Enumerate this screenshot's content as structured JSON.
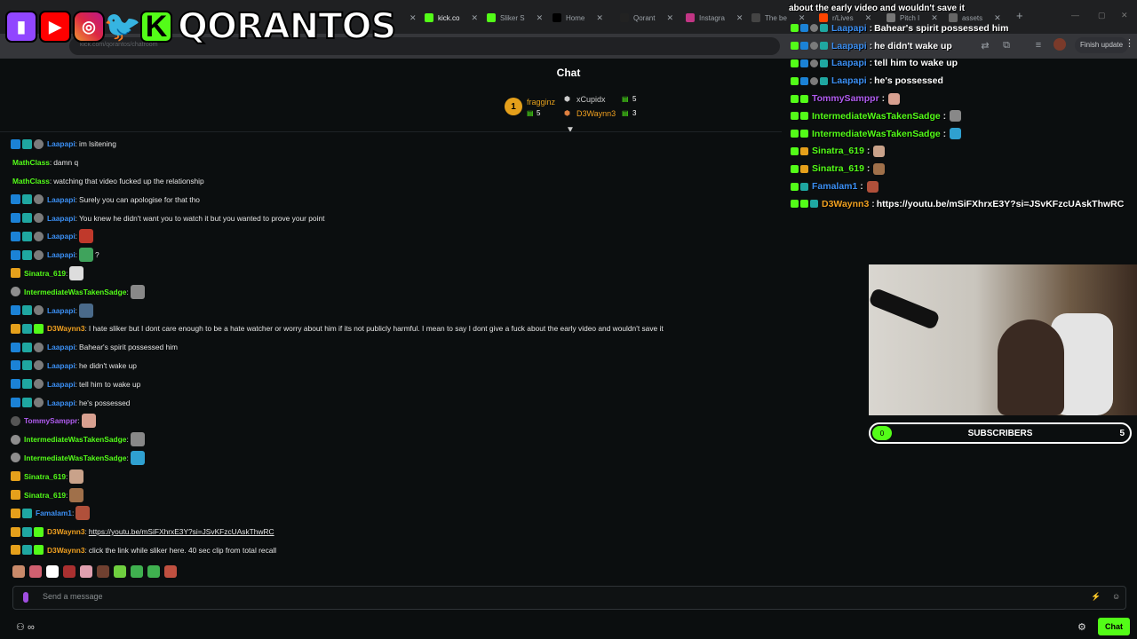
{
  "browser": {
    "tabs": [
      {
        "label": "",
        "active": false
      },
      {
        "label": "kick.co",
        "active": true
      },
      {
        "label": "Sliker S",
        "active": false
      },
      {
        "label": "Home",
        "active": false
      },
      {
        "label": "Qorant",
        "active": false
      },
      {
        "label": "Instagra",
        "active": false
      },
      {
        "label": "The be",
        "active": false
      },
      {
        "label": "r/Lives",
        "active": false
      },
      {
        "label": "Pitch I",
        "active": false
      },
      {
        "label": "assets",
        "active": false
      }
    ],
    "new_tab": "+",
    "url": "kick.com/qorantos/chatroom",
    "finish_update": "Finish update"
  },
  "overlay_brand": {
    "name": "QORANTOS"
  },
  "chat": {
    "header": "Chat",
    "leaderboard": [
      {
        "rank": "1",
        "name": "fragginz",
        "count": "5"
      },
      {
        "name": "xCupidx",
        "count": "5"
      },
      {
        "name": "D3Waynn3",
        "count": "3"
      }
    ],
    "messages": [
      {
        "badges": [
          "mod",
          "sub",
          "og"
        ],
        "user": "Laapapi",
        "color": "#3b8ff3",
        "text": "im lsitening"
      },
      {
        "badges": [],
        "user": "MathClass",
        "color": "#53fc18",
        "text": "damn q"
      },
      {
        "badges": [],
        "user": "MathClass",
        "color": "#53fc18",
        "text": "watching that video fucked up the relationship"
      },
      {
        "badges": [
          "mod",
          "sub",
          "og"
        ],
        "user": "Laapapi",
        "color": "#3b8ff3",
        "text": "Surely you can apologise for that tho"
      },
      {
        "badges": [
          "mod",
          "sub",
          "og"
        ],
        "user": "Laapapi",
        "color": "#3b8ff3",
        "text": "You knew he didn't want you to watch it but you wanted to prove your point"
      },
      {
        "badges": [
          "mod",
          "sub",
          "og"
        ],
        "user": "Laapapi",
        "color": "#3b8ff3",
        "text": "",
        "emote": "#c0392b"
      },
      {
        "badges": [
          "mod",
          "sub",
          "og"
        ],
        "user": "Laapapi",
        "color": "#3b8ff3",
        "text": "?",
        "emote": "#3fa35c"
      },
      {
        "badges": [
          "vip"
        ],
        "user": "Sinatra_619",
        "color": "#53fc18",
        "text": "",
        "emote": "#dddddd"
      },
      {
        "badges": [
          "founder"
        ],
        "user": "IntermediateWasTakenSadge",
        "color": "#53fc18",
        "text": "",
        "emote": "#888888"
      },
      {
        "badges": [
          "mod",
          "sub",
          "og"
        ],
        "user": "Laapapi",
        "color": "#3b8ff3",
        "text": "",
        "emote": "#4a6a8a"
      },
      {
        "badges": [
          "vip",
          "sub",
          "gift"
        ],
        "user": "D3Waynn3",
        "color": "#f0a020",
        "text": "I hate sliker but I dont care enough to be a hate watcher or worry about him if its not publicly harmful. I mean to say I dont give a fuck about the early video and wouldn't save it"
      },
      {
        "badges": [
          "mod",
          "sub",
          "og"
        ],
        "user": "Laapapi",
        "color": "#3b8ff3",
        "text": "Bahear's spirit possessed him"
      },
      {
        "badges": [
          "mod",
          "sub",
          "og"
        ],
        "user": "Laapapi",
        "color": "#3b8ff3",
        "text": "he didn't wake up"
      },
      {
        "badges": [
          "mod",
          "sub",
          "og"
        ],
        "user": "Laapapi",
        "color": "#3b8ff3",
        "text": "tell him to wake up"
      },
      {
        "badges": [
          "mod",
          "sub",
          "og"
        ],
        "user": "Laapapi",
        "color": "#3b8ff3",
        "text": "he's possessed"
      },
      {
        "badges": [
          "gray"
        ],
        "user": "TommySamppr",
        "color": "#b05cf0",
        "text": "",
        "emote": "#d8a090"
      },
      {
        "badges": [
          "founder"
        ],
        "user": "IntermediateWasTakenSadge",
        "color": "#53fc18",
        "text": "",
        "emote": "#888888"
      },
      {
        "badges": [
          "founder"
        ],
        "user": "IntermediateWasTakenSadge",
        "color": "#53fc18",
        "text": "",
        "emote": "#2fa0d0"
      },
      {
        "badges": [
          "vip"
        ],
        "user": "Sinatra_619",
        "color": "#53fc18",
        "text": "",
        "emote": "#c9a28a"
      },
      {
        "badges": [
          "vip"
        ],
        "user": "Sinatra_619",
        "color": "#53fc18",
        "text": "",
        "emote": "#a0704a"
      },
      {
        "badges": [
          "vip",
          "sub"
        ],
        "user": "Famalam1",
        "color": "#3b8ff3",
        "text": "",
        "emote": "#b0503a"
      },
      {
        "badges": [
          "vip",
          "sub",
          "gift"
        ],
        "user": "D3Waynn3",
        "color": "#f0a020",
        "text": "https://youtu.be/mSiFXhrxE3Y?si=JSvKFzcUAskThwRC",
        "link": true
      },
      {
        "badges": [
          "vip",
          "sub",
          "gift"
        ],
        "user": "D3Waynn3",
        "color": "#f0a020",
        "text": "click the link while sliker here. 40 sec clip from total recall"
      }
    ],
    "emote_strip": [
      "#c98a6a",
      "#d06070",
      "#ffffff",
      "#aa3030",
      "#e0a0b0",
      "#704030",
      "#6fcf3f",
      "#3fb04f",
      "#3fb04f",
      "#c05040"
    ],
    "input_placeholder": "Send a message",
    "send_label": "Chat",
    "bottom_left": "∞"
  },
  "overlay_chat": {
    "top_text": "about the early video and wouldn't save it",
    "messages": [
      {
        "badges": [
          "k",
          "mod",
          "og",
          "sub"
        ],
        "user": "Laapapi",
        "color": "#3b8ff3",
        "text": "Bahear's spirit possessed him"
      },
      {
        "badges": [
          "k",
          "mod",
          "og",
          "sub"
        ],
        "user": "Laapapi",
        "color": "#3b8ff3",
        "text": "he didn't wake up"
      },
      {
        "badges": [
          "k",
          "mod",
          "og",
          "sub"
        ],
        "user": "Laapapi",
        "color": "#3b8ff3",
        "text": "tell him to wake up"
      },
      {
        "badges": [
          "k",
          "mod",
          "og",
          "sub"
        ],
        "user": "Laapapi",
        "color": "#3b8ff3",
        "text": "he's possessed"
      },
      {
        "badges": [
          "k",
          "gift"
        ],
        "user": "TommySamppr",
        "color": "#b05cf0",
        "text": "",
        "emote": "#d8a090"
      },
      {
        "badges": [
          "k",
          "gift"
        ],
        "user": "IntermediateWasTakenSadge",
        "color": "#53fc18",
        "text": "",
        "emote": "#888888"
      },
      {
        "badges": [
          "k",
          "gift"
        ],
        "user": "IntermediateWasTakenSadge",
        "color": "#53fc18",
        "text": "",
        "emote": "#2fa0d0"
      },
      {
        "badges": [
          "k",
          "vip"
        ],
        "user": "Sinatra_619",
        "color": "#53fc18",
        "text": "",
        "emote": "#c9a28a"
      },
      {
        "badges": [
          "k",
          "vip"
        ],
        "user": "Sinatra_619",
        "color": "#53fc18",
        "text": "",
        "emote": "#a0704a"
      },
      {
        "badges": [
          "k",
          "sub"
        ],
        "user": "Famalam1",
        "color": "#3b8ff3",
        "text": "",
        "emote": "#b0503a"
      },
      {
        "badges": [
          "k",
          "gift",
          "sub"
        ],
        "user": "D3Waynn3",
        "color": "#f0a020",
        "text": "https://youtu.be/mSiFXhrxE3Y?si=JSvKFzcUAskThwRC"
      }
    ]
  },
  "sub_goal": {
    "current": "0",
    "label": "SUBSCRIBERS",
    "target": "5"
  },
  "colors": {
    "kick_green": "#53fc18",
    "bg": "#0b0e0f"
  }
}
